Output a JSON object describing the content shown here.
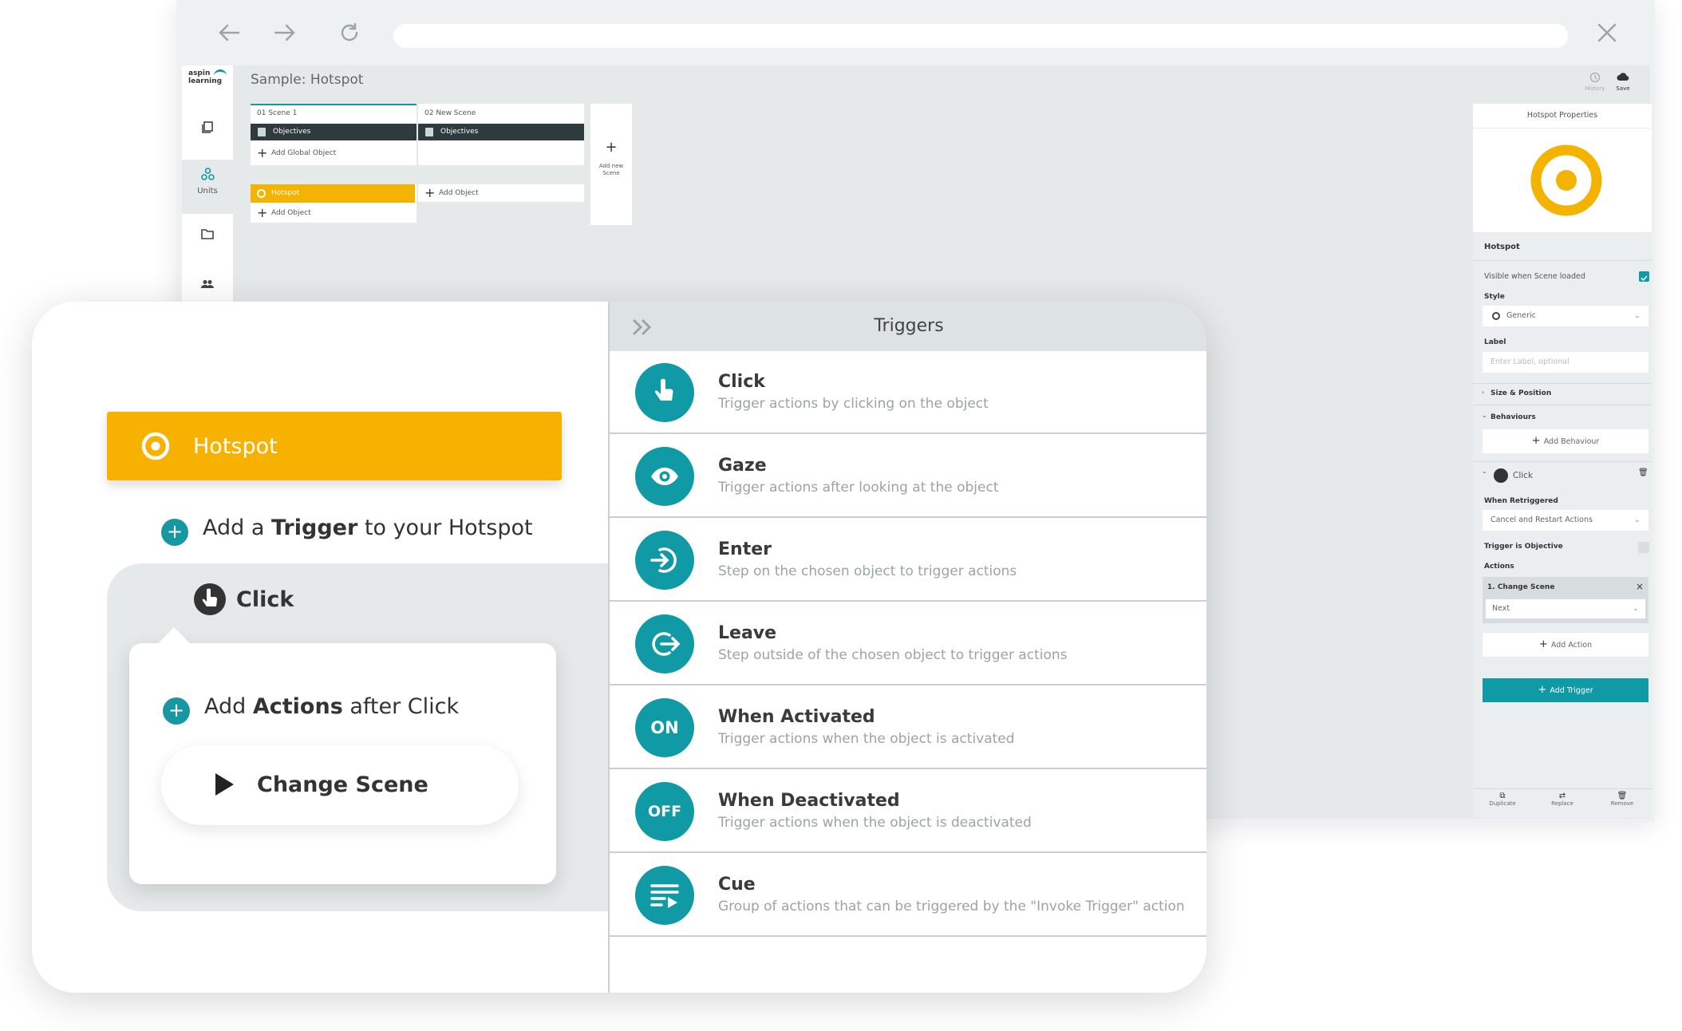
{
  "app": {
    "logo_line1": "aspin",
    "logo_line2": "learning",
    "title": "Sample: Hotspot",
    "history_label": "History",
    "save_label": "Save"
  },
  "nav": {
    "units_label": "Units"
  },
  "scenes": [
    {
      "label": "01  Scene 1",
      "objectives": "Objectives"
    },
    {
      "label": "02  New Scene",
      "objectives": "Objectives"
    }
  ],
  "scene_actions": {
    "add_global_object": "Add Global Object",
    "add_new_scene_line1": "Add new",
    "add_new_scene_line2": "Scene",
    "hotspot_small": "Hotspot",
    "add_object_1": "Add Object",
    "add_object_2": "Add Object"
  },
  "properties": {
    "header": "Hotspot Properties",
    "object_name": "Hotspot",
    "visible_label": "Visible when Scene loaded",
    "style_label": "Style",
    "style_value": "Generic",
    "label_label": "Label",
    "label_placeholder": "Enter Label, optional",
    "size_position": "Size & Position",
    "behaviours": "Behaviours",
    "add_behaviour": "Add Behaviour",
    "trigger_name": "Click",
    "when_retriggered_label": "When Retriggered",
    "when_retriggered_value": "Cancel and Restart Actions",
    "trigger_is_objective": "Trigger is Objective",
    "actions_label": "Actions",
    "action_1": "1. Change Scene",
    "action_1_value": "Next",
    "add_action": "Add Action",
    "add_trigger": "Add Trigger",
    "duplicate": "Duplicate",
    "replace": "Replace",
    "remove": "Remove",
    "accent": "#109aa5",
    "hotspot_color": "#f4b300"
  },
  "overlay": {
    "hotspot_label": "Hotspot",
    "add_trigger_pre": "Add a ",
    "add_trigger_bold": "Trigger",
    "add_trigger_post": " to your Hotspot",
    "click_label": "Click",
    "add_actions_pre": "Add ",
    "add_actions_bold": "Actions",
    "add_actions_post": " after Click",
    "change_scene": "Change Scene"
  },
  "triggers": {
    "header": "Triggers",
    "items": [
      {
        "title": "Click",
        "desc": "Trigger actions by clicking on the object",
        "icon": "hand-pointer-icon"
      },
      {
        "title": "Gaze",
        "desc": "Trigger actions after looking at the object",
        "icon": "eye-icon"
      },
      {
        "title": "Enter",
        "desc": "Step on the chosen object to trigger actions",
        "icon": "enter-arrow-icon"
      },
      {
        "title": "Leave",
        "desc": "Step outside of the chosen object to trigger actions",
        "icon": "leave-arrow-icon"
      },
      {
        "title": "When Activated",
        "desc": "Trigger actions when the object is activated",
        "badge": "ON"
      },
      {
        "title": "When Deactivated",
        "desc": "Trigger actions when the object is deactivated",
        "badge": "OFF"
      },
      {
        "title": "Cue",
        "desc": "Group of actions that can be triggered by the \"Invoke Trigger\" action",
        "icon": "cue-list-icon"
      }
    ]
  }
}
